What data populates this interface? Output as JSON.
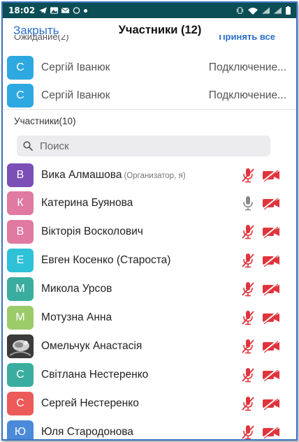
{
  "status_bar": {
    "time": "18:02"
  },
  "header": {
    "close_label": "Закрыть",
    "title": "Участники (12)"
  },
  "waiting": {
    "label": "Ожидание(2)",
    "admit_all_label": "Принять все",
    "items": [
      {
        "initial": "С",
        "name": "Сергій Іванюк",
        "status": "Подключение...",
        "color": "#2ea8e0"
      },
      {
        "initial": "С",
        "name": "Сергій Іванюк",
        "status": "Подключение...",
        "color": "#2ea8e0"
      }
    ]
  },
  "participants": {
    "label": "Участники(10)",
    "search_placeholder": "Поиск",
    "items": [
      {
        "initial": "В",
        "name": "Вика Алмашова",
        "role": "(Организатор, я)",
        "color": "#7b4fb6",
        "mic": "muted",
        "video": "off"
      },
      {
        "initial": "К",
        "name": "Катерина Буянова",
        "role": "",
        "color": "#e07aa0",
        "mic": "on",
        "video": "off"
      },
      {
        "initial": "В",
        "name": "Вікторія Восколович",
        "role": "",
        "color": "#e07aa0",
        "mic": "muted",
        "video": "off"
      },
      {
        "initial": "Е",
        "name": "Евген Косенко (Староста)",
        "role": "",
        "color": "#2ec1d8",
        "mic": "muted",
        "video": "off"
      },
      {
        "initial": "М",
        "name": "Микола Урсов",
        "role": "",
        "color": "#3aada0",
        "mic": "muted",
        "video": "off"
      },
      {
        "initial": "М",
        "name": "Мотузна Анна",
        "role": "",
        "color": "#9ccb6a",
        "mic": "muted",
        "video": "off"
      },
      {
        "initial": "",
        "name": "Омельчук Анастасія",
        "role": "",
        "color": "#3a3a3a",
        "mic": "muted",
        "video": "off",
        "photo": true
      },
      {
        "initial": "С",
        "name": "Світлана Нестеренко",
        "role": "",
        "color": "#3aada0",
        "mic": "muted",
        "video": "off"
      },
      {
        "initial": "С",
        "name": "Сергей Нестеренко",
        "role": "",
        "color": "#ec5a5a",
        "mic": "muted",
        "video": "off"
      },
      {
        "initial": "Ю",
        "name": "Юля Стародонова",
        "role": "",
        "color": "#4a8ad8",
        "mic": "muted",
        "video": "off"
      }
    ]
  },
  "colors": {
    "accent": "#2a6fc9",
    "muted_red": "#e0343c",
    "statusbar": "#0c4e55"
  }
}
